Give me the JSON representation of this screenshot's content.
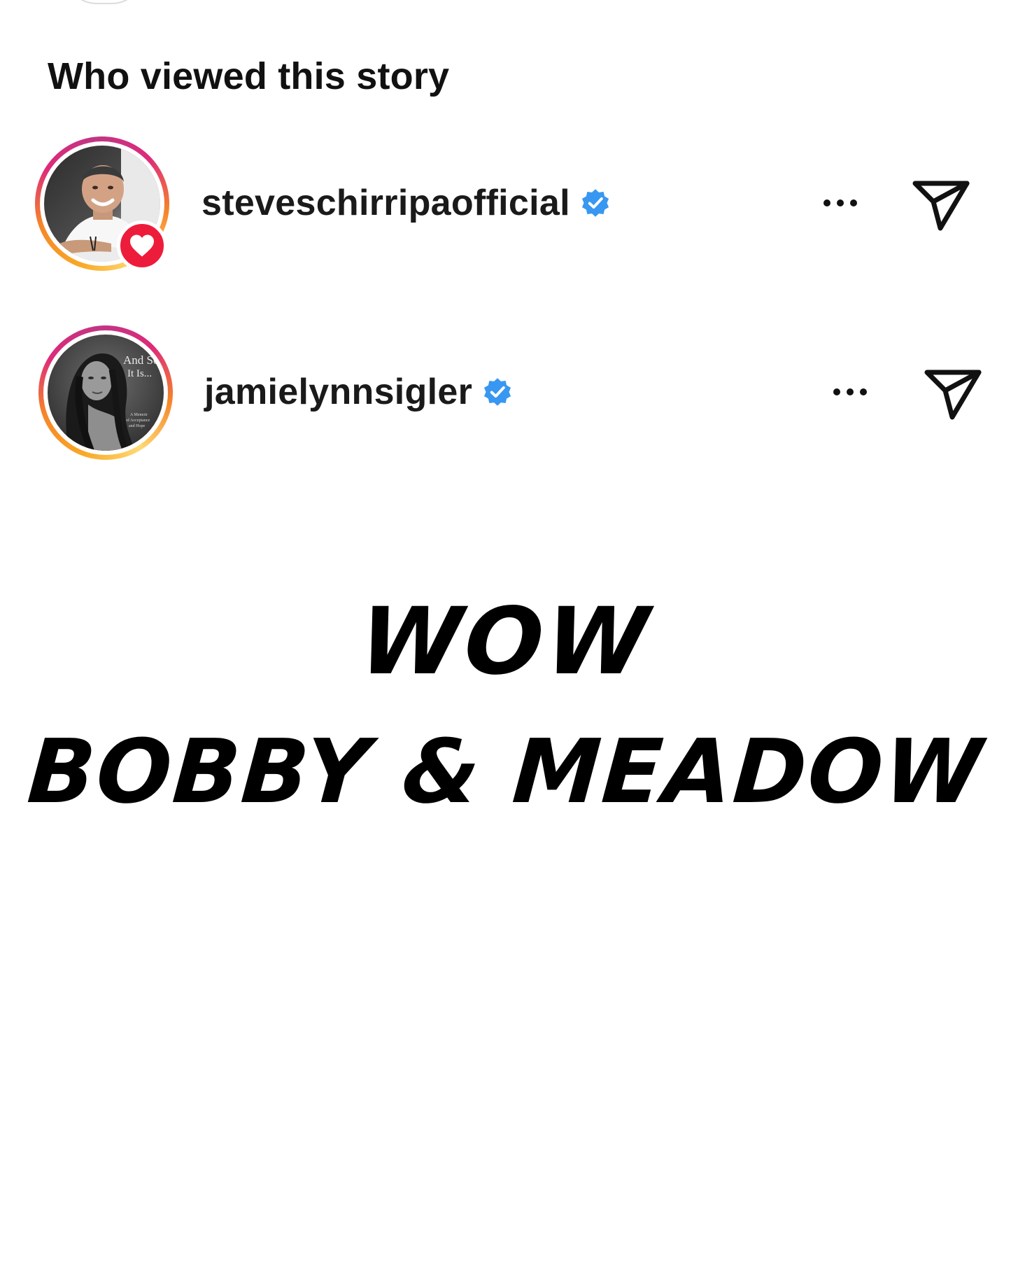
{
  "header": {
    "title": "Who viewed this story"
  },
  "viewers": [
    {
      "username": "steveschirripaofficial",
      "verified": true,
      "liked": true,
      "avatar": "man-white-shirt-photo",
      "more_icon": "more-horizontal-icon",
      "send_icon": "paper-plane-icon"
    },
    {
      "username": "jamielynnsigler",
      "verified": true,
      "liked": false,
      "avatar": "book-cover-photo",
      "avatar_text": {
        "title_line1": "And So",
        "title_line2": "It Is...",
        "subtitle_line1": "A Memoir",
        "subtitle_line2": "of Acceptance",
        "subtitle_line3": "and Hope"
      },
      "more_icon": "more-horizontal-icon",
      "send_icon": "paper-plane-icon"
    }
  ],
  "caption": {
    "line1": "WOW",
    "line2": "BOBBY & MEADOW"
  },
  "colors": {
    "story_ring_start": "#f9a825",
    "story_ring_mid": "#dd2a7b",
    "verified_blue": "#3897f0",
    "like_red": "#ed1c3a",
    "text": "#111111",
    "background": "#ffffff"
  }
}
